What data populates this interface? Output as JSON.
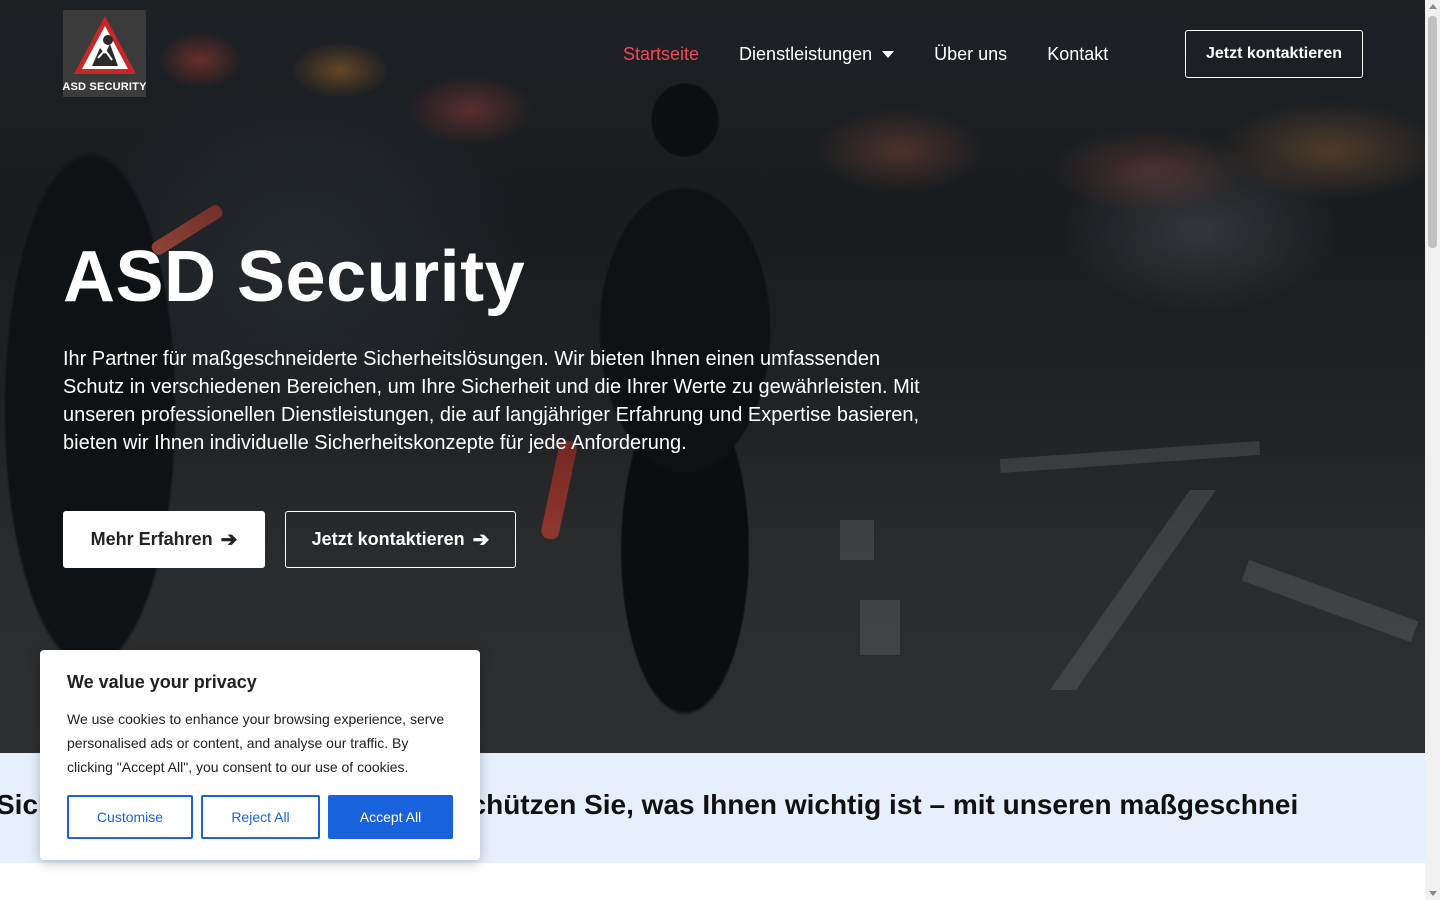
{
  "logo": {
    "text": "ASD SECURITY"
  },
  "nav": {
    "items": [
      {
        "label": "Startseite"
      },
      {
        "label": "Dienstleistungen"
      },
      {
        "label": "Über uns"
      },
      {
        "label": "Kontakt"
      }
    ],
    "cta": "Jetzt kontaktieren"
  },
  "hero": {
    "title": "ASD Security",
    "description": "Ihr Partner für maßgeschneiderte Sicherheitslösungen. Wir bieten Ihnen einen umfassenden Schutz in verschiedenen Bereichen, um Ihre Sicherheit und die Ihrer Werte zu gewährleisten. Mit unseren professionellen Dienstleistungen, die auf langjähriger Erfahrung und Expertise basieren, bieten wir Ihnen individuelle Sicherheitskonzepte für jede Anforderung.",
    "primary_button": "Mehr Erfahren",
    "secondary_button": "Jetzt kontaktieren"
  },
  "ticker": {
    "text": "Sich                                    können! Schützen Sie, was Ihnen wichtig ist – mit unseren maßgeschnei"
  },
  "cookie": {
    "title": "We value your privacy",
    "text": "We use cookies to enhance your browsing experience, serve personalised ads or content, and analyse our traffic. By clicking \"Accept All\", you consent to our use of cookies.",
    "customise": "Customise",
    "reject": "Reject All",
    "accept": "Accept All"
  },
  "colors": {
    "nav_active": "#f2495a",
    "ticker_bg": "#e6f0fc",
    "cookie_accent": "#1863dc"
  }
}
